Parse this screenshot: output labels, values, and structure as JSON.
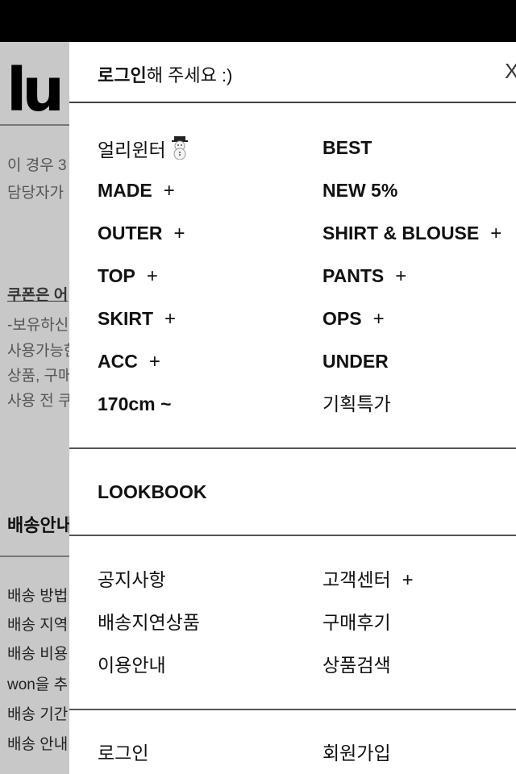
{
  "background": {
    "logo": "lu",
    "lines": [
      "이 경우 3",
      "담당자가"
    ],
    "coupon_link": "쿠폰은 어",
    "coupon_lines": [
      "-보유하신",
      "사용가능한",
      "상품, 구매",
      "사용 전 쿠"
    ],
    "shipping_heading": "배송안내",
    "shipping_lines": [
      "배송 방법",
      "배송 지역",
      "배송 비용",
      "won을 추",
      "배송 기간",
      "배송 안내"
    ]
  },
  "drawer": {
    "login_prompt_bold": "로그인",
    "login_prompt_rest": "해 주세요 :)",
    "close_label": "X",
    "categories": [
      {
        "label": "얼리윈터",
        "icon": "snowman-icon",
        "plus": false
      },
      {
        "label": "BEST",
        "plus": false
      },
      {
        "label": "MADE",
        "plus": true
      },
      {
        "label": "NEW 5%",
        "plus": false
      },
      {
        "label": "OUTER",
        "plus": true
      },
      {
        "label": "SHIRT & BLOUSE",
        "plus": true
      },
      {
        "label": "TOP",
        "plus": true
      },
      {
        "label": "PANTS",
        "plus": true
      },
      {
        "label": "SKIRT",
        "plus": true
      },
      {
        "label": "OPS",
        "plus": true
      },
      {
        "label": "ACC",
        "plus": true
      },
      {
        "label": "UNDER",
        "plus": false
      },
      {
        "label": "170cm ~",
        "plus": false
      },
      {
        "label": "기획특가",
        "plus": false
      }
    ],
    "plus_label": "+",
    "lookbook": "LOOKBOOK",
    "community": {
      "notice": "공지사항",
      "customer_center": "고객센터",
      "delayed_products": "배송지연상품",
      "reviews": "구매후기",
      "guide": "이용안내",
      "product_search": "상품검색"
    },
    "account": {
      "login": "로그인",
      "join": "회원가입"
    }
  }
}
